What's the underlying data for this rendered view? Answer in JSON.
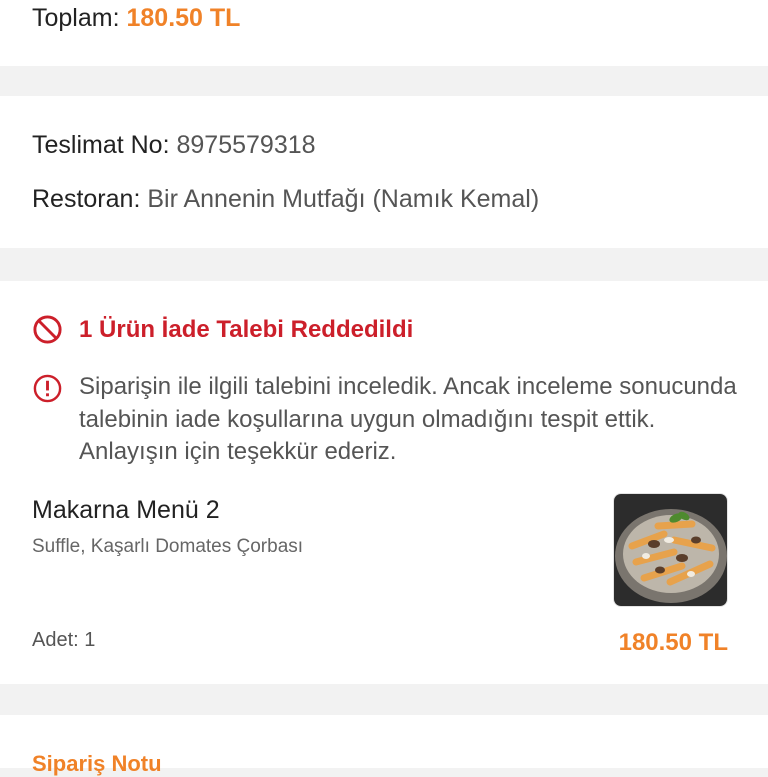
{
  "total": {
    "label": "Toplam:",
    "value": "180.50 TL"
  },
  "delivery": {
    "no_label": "Teslimat No:",
    "no_value": "8975579318",
    "restaurant_label": "Restoran:",
    "restaurant_value": "Bir Annenin Mutfağı (Namık Kemal)"
  },
  "refund": {
    "title": "1 Ürün İade Talebi Reddedildi",
    "message": "Siparişin ile ilgili talebini inceledik. Ancak inceleme sonucunda talebinin iade koşullarına uygun olmadığını tespit ettik. Anlayışın için teşekkür ederiz.",
    "status_icon": "prohibited-icon",
    "info_icon": "info-icon",
    "status_color": "#cc1f2a"
  },
  "product": {
    "name": "Makarna Menü 2",
    "description": "Suffle, Kaşarlı Domates Çorbası",
    "quantity": "Adet: 1",
    "price": "180.50 TL",
    "image": "pasta-dish-image"
  },
  "note": {
    "title": "Sipariş Notu"
  },
  "colors": {
    "accent": "#f08228",
    "error": "#cc1f2a"
  }
}
